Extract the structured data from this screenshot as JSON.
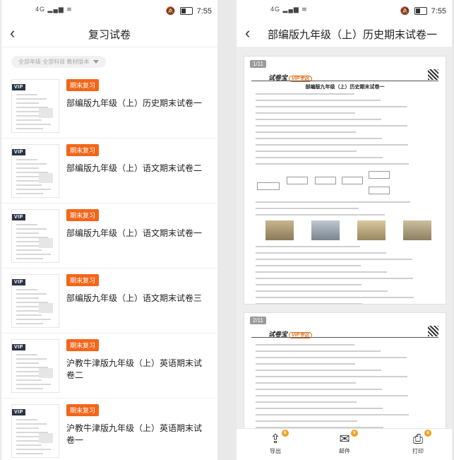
{
  "status": {
    "signal": "4G",
    "time_left": "7:55",
    "time_right": "7:55"
  },
  "left": {
    "title": "复习试卷",
    "filter": "全部年级 全部科目 教材版本",
    "items": [
      {
        "tag": "期末复习",
        "title": "部编版九年级（上）历史期末试卷一",
        "vip": "VIP"
      },
      {
        "tag": "期末复习",
        "title": "部编版九年级（上）语文期末试卷二",
        "vip": "VIP"
      },
      {
        "tag": "期末复习",
        "title": "部编版九年级（上）语文期末试卷一",
        "vip": "VIP"
      },
      {
        "tag": "期末复习",
        "title": "部编版九年级（上）语文期末试卷三",
        "vip": "VIP"
      },
      {
        "tag": "期末复习",
        "title": "沪教牛津版九年级（上）英语期末试卷二",
        "vip": "VIP"
      },
      {
        "tag": "期末复习",
        "title": "沪教牛津版九年级（上）英语期末试卷一",
        "vip": "VIP"
      }
    ]
  },
  "right": {
    "title": "部编版九年级（上）历史期末试卷一",
    "pages": [
      {
        "no": "1/11",
        "brand": "试卷宝",
        "vip": "VIP专区",
        "doc_title": "部编版九年级（上）历史期末试卷一"
      },
      {
        "no": "2/11",
        "brand": "试卷宝",
        "vip": "VIP专区"
      }
    ],
    "toolbar": {
      "export": "导出",
      "mail": "邮件",
      "print": "打印"
    }
  },
  "icons": {
    "back": "chevron-left-icon",
    "share": "export-icon",
    "mail": "mail-icon",
    "print": "printer-icon",
    "crown": "crown-icon"
  }
}
